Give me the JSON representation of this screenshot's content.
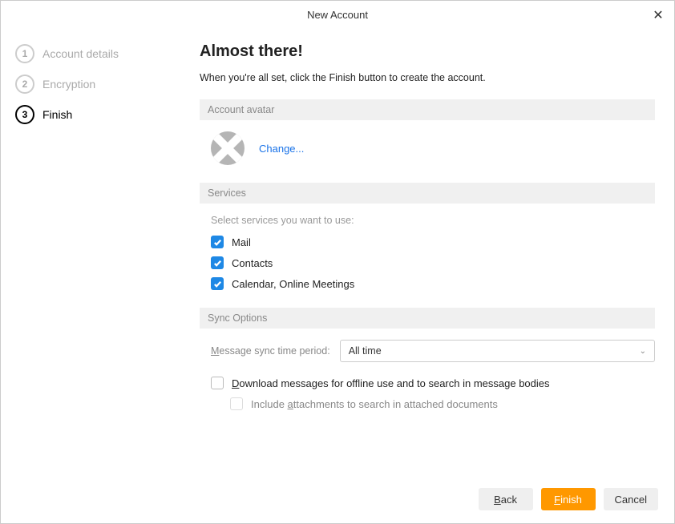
{
  "dialog": {
    "title": "New Account"
  },
  "steps": [
    {
      "num": "1",
      "label": "Account details"
    },
    {
      "num": "2",
      "label": "Encryption"
    },
    {
      "num": "3",
      "label": "Finish"
    }
  ],
  "heading": "Almost there!",
  "subheading": "When you're all set, click the Finish button to create the account.",
  "sections": {
    "avatar": {
      "title": "Account avatar",
      "change": "Change..."
    },
    "services": {
      "title": "Services",
      "hint": "Select services you want to use:",
      "items": [
        {
          "label": "Mail",
          "checked": true
        },
        {
          "label": "Contacts",
          "checked": true
        },
        {
          "label": "Calendar, Online Meetings",
          "checked": true
        }
      ]
    },
    "sync": {
      "title": "Sync Options",
      "period_label_pre": "M",
      "period_label_rest": "essage sync time period:",
      "period_value": "All time",
      "download_pre": "D",
      "download_rest": "ownload messages for offline use and to search in message bodies",
      "attach_pre": "Include ",
      "attach_u": "a",
      "attach_rest": "ttachments to search in attached documents"
    }
  },
  "buttons": {
    "back_u": "B",
    "back_rest": "ack",
    "finish_u": "F",
    "finish_rest": "inish",
    "cancel": "Cancel"
  }
}
